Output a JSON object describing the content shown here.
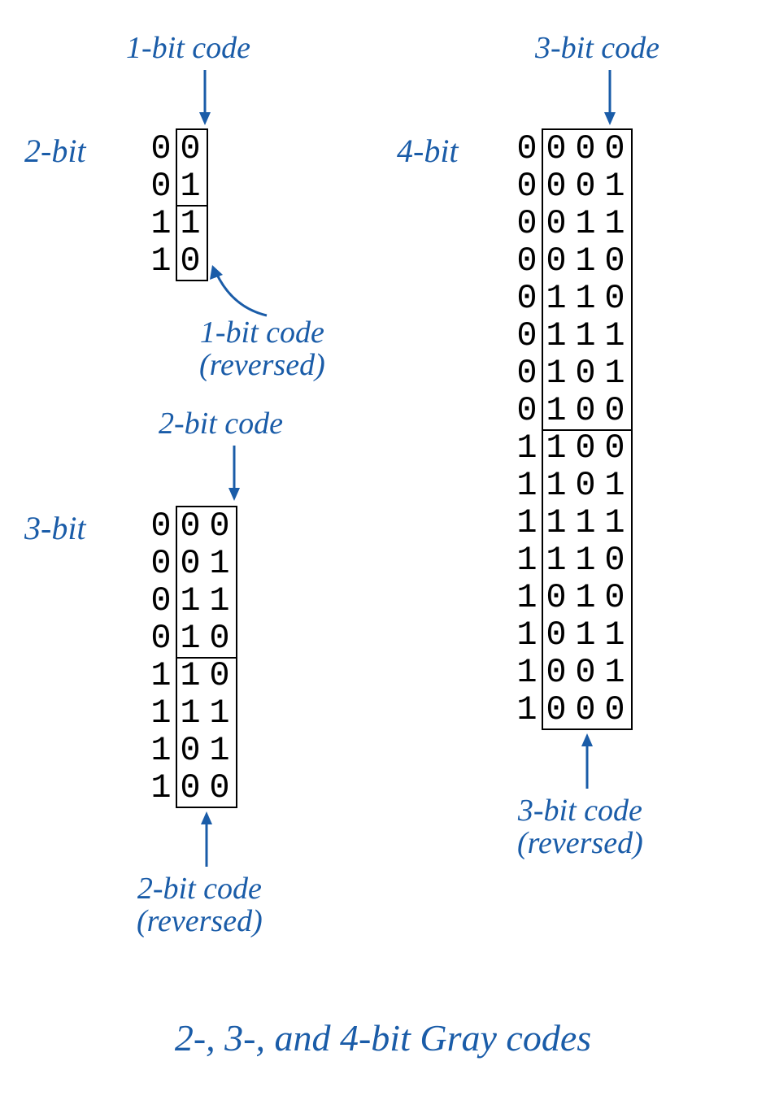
{
  "caption": "2-, 3-, and 4-bit Gray codes",
  "blocks": {
    "two": {
      "title": "2-bit",
      "topLabel": "1-bit code",
      "bottomLabel1": "1-bit code",
      "bottomLabel2": "(reversed)",
      "rows": [
        [
          "0",
          "0"
        ],
        [
          "0",
          "1"
        ],
        [
          "1",
          "1"
        ],
        [
          "1",
          "0"
        ]
      ]
    },
    "three": {
      "title": "3-bit",
      "topLabel": "2-bit code",
      "bottomLabel1": "2-bit code",
      "bottomLabel2": "(reversed)",
      "rows": [
        [
          "0",
          "0",
          "0"
        ],
        [
          "0",
          "0",
          "1"
        ],
        [
          "0",
          "1",
          "1"
        ],
        [
          "0",
          "1",
          "0"
        ],
        [
          "1",
          "1",
          "0"
        ],
        [
          "1",
          "1",
          "1"
        ],
        [
          "1",
          "0",
          "1"
        ],
        [
          "1",
          "0",
          "0"
        ]
      ]
    },
    "four": {
      "title": "4-bit",
      "topLabel": "3-bit code",
      "bottomLabel1": "3-bit code",
      "bottomLabel2": "(reversed)",
      "rows": [
        [
          "0",
          "0",
          "0",
          "0"
        ],
        [
          "0",
          "0",
          "0",
          "1"
        ],
        [
          "0",
          "0",
          "1",
          "1"
        ],
        [
          "0",
          "0",
          "1",
          "0"
        ],
        [
          "0",
          "1",
          "1",
          "0"
        ],
        [
          "0",
          "1",
          "1",
          "1"
        ],
        [
          "0",
          "1",
          "0",
          "1"
        ],
        [
          "0",
          "1",
          "0",
          "0"
        ],
        [
          "1",
          "1",
          "0",
          "0"
        ],
        [
          "1",
          "1",
          "0",
          "1"
        ],
        [
          "1",
          "1",
          "1",
          "1"
        ],
        [
          "1",
          "1",
          "1",
          "0"
        ],
        [
          "1",
          "0",
          "1",
          "0"
        ],
        [
          "1",
          "0",
          "1",
          "1"
        ],
        [
          "1",
          "0",
          "0",
          "1"
        ],
        [
          "1",
          "0",
          "0",
          "0"
        ]
      ]
    }
  }
}
